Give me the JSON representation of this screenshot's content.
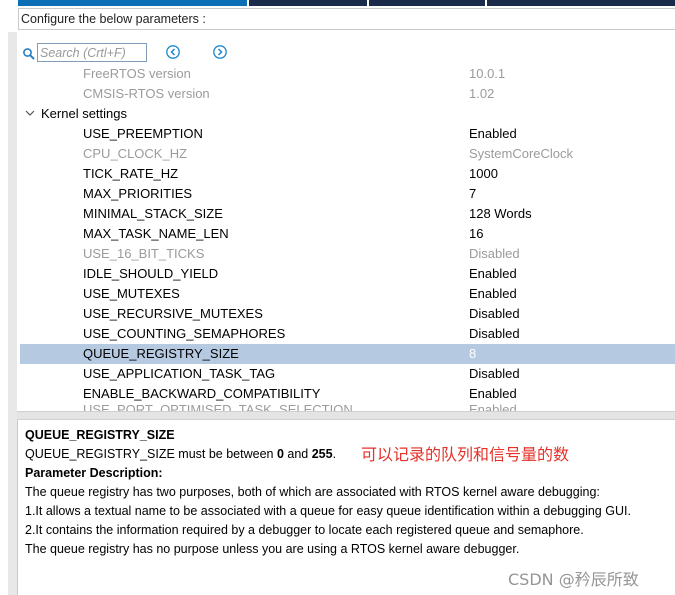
{
  "header": {
    "config_label": "Configure the below parameters :"
  },
  "search": {
    "placeholder": "Search (Crtl+F)"
  },
  "info_rows": [
    {
      "name": "FreeRTOS version",
      "value": "10.0.1",
      "disabled": true
    },
    {
      "name": "CMSIS-RTOS version",
      "value": "1.02",
      "disabled": true
    }
  ],
  "kernel_group": {
    "label": "Kernel settings",
    "expanded": true
  },
  "kernel_rows": [
    {
      "name": "USE_PREEMPTION",
      "value": "Enabled",
      "disabled": false
    },
    {
      "name": "CPU_CLOCK_HZ",
      "value": "SystemCoreClock",
      "disabled": true
    },
    {
      "name": "TICK_RATE_HZ",
      "value": "1000",
      "disabled": false
    },
    {
      "name": "MAX_PRIORITIES",
      "value": "7",
      "disabled": false
    },
    {
      "name": "MINIMAL_STACK_SIZE",
      "value": "128 Words",
      "disabled": false
    },
    {
      "name": "MAX_TASK_NAME_LEN",
      "value": "16",
      "disabled": false
    },
    {
      "name": "USE_16_BIT_TICKS",
      "value": "Disabled",
      "disabled": true
    },
    {
      "name": "IDLE_SHOULD_YIELD",
      "value": "Enabled",
      "disabled": false
    },
    {
      "name": "USE_MUTEXES",
      "value": "Enabled",
      "disabled": false
    },
    {
      "name": "USE_RECURSIVE_MUTEXES",
      "value": "Disabled",
      "disabled": false
    },
    {
      "name": "USE_COUNTING_SEMAPHORES",
      "value": "Disabled",
      "disabled": false
    },
    {
      "name": "QUEUE_REGISTRY_SIZE",
      "value": "8",
      "disabled": false,
      "selected": true
    },
    {
      "name": "USE_APPLICATION_TASK_TAG",
      "value": "Disabled",
      "disabled": false
    },
    {
      "name": "ENABLE_BACKWARD_COMPATIBILITY",
      "value": "Enabled",
      "disabled": false
    },
    {
      "name": "USE_PORT_OPTIMISED_TASK_SELECTION",
      "value": "Enabled",
      "disabled": false,
      "partially_visible": true
    }
  ],
  "description": {
    "title": "QUEUE_REGISTRY_SIZE",
    "range_prefix": "QUEUE_REGISTRY_SIZE must be between ",
    "range_min": "0",
    "range_and": " and ",
    "range_max": "255",
    "range_suffix": ".",
    "param_heading": "Parameter Description:",
    "lines": [
      "The queue registry has two purposes, both of which are associated with RTOS kernel aware debugging:",
      "1.It allows a textual name to be associated with a queue for easy queue identification within a debugging GUI.",
      "2.It contains the information required by a debugger to locate each registered queue and semaphore.",
      "The queue registry has no purpose unless you are using a RTOS kernel aware debugger."
    ]
  },
  "annotation": {
    "text": "可以记录的队列和信号量的数"
  },
  "watermark": {
    "text": "CSDN @矜辰所致"
  },
  "colors": {
    "selected_row": "#b5c9e0",
    "disabled_text": "#9b9b9b",
    "annotation": "#e5312a",
    "nav_icon": "#1e88c9",
    "active_tab": "#0c6eb4",
    "inactive_tab": "#1b2a4b"
  }
}
